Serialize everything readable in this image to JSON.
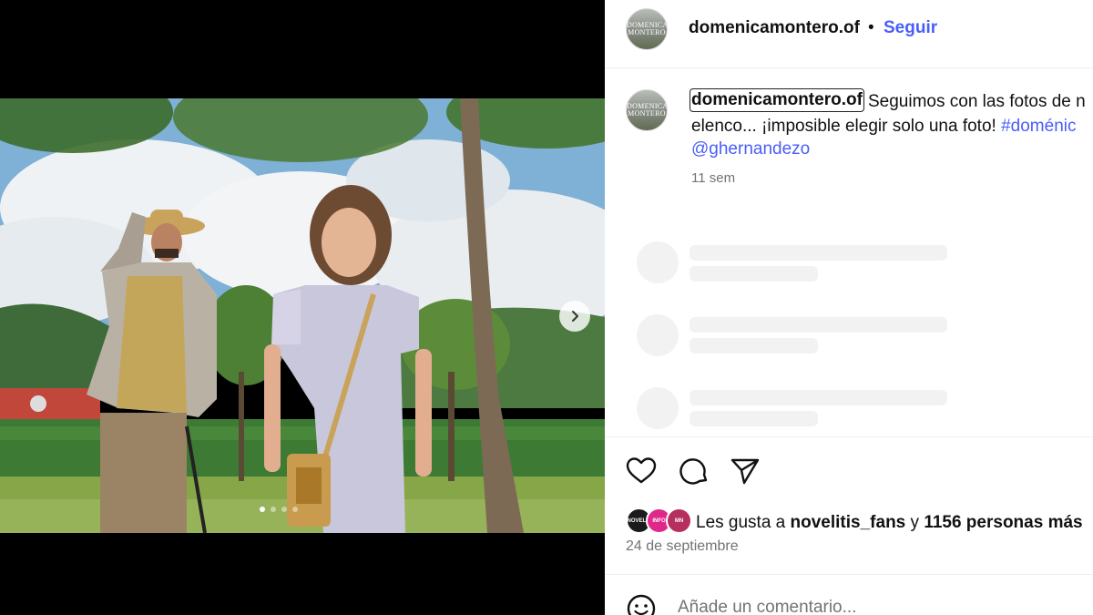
{
  "post": {
    "username": "domenicamontero.of",
    "follow_label": "Seguir",
    "separator": "•",
    "avatar_text": "DOMENICA MONTERO",
    "carousel": {
      "slide_count": 4,
      "active_index": 0,
      "next_icon": "chevron-right-icon"
    }
  },
  "caption": {
    "username": "domenicamontero.of",
    "line1": "Seguimos con las fotos de n",
    "line2_text": "elenco... ¡imposible elegir solo una foto! ",
    "line2_hashtag": "#doménic",
    "mention": "@ghernandezo",
    "time_ago": "11 sem"
  },
  "actions": {
    "like_icon": "heart-icon",
    "comment_icon": "comment-icon",
    "share_icon": "send-icon"
  },
  "likes": {
    "prefix": "Les gusta a ",
    "user": "novelitis_fans",
    "middle": " y ",
    "count_text": "1156 personas más",
    "avatars": [
      {
        "label": "NOVELIT",
        "color": "#1b1b1b"
      },
      {
        "label": "INFO",
        "color": "#e0288a"
      },
      {
        "label": "MN",
        "color": "#b5305f"
      }
    ]
  },
  "date": "24 de septiembre",
  "comment": {
    "placeholder": "Añade un comentario...",
    "emoji_icon": "smiley-icon"
  }
}
